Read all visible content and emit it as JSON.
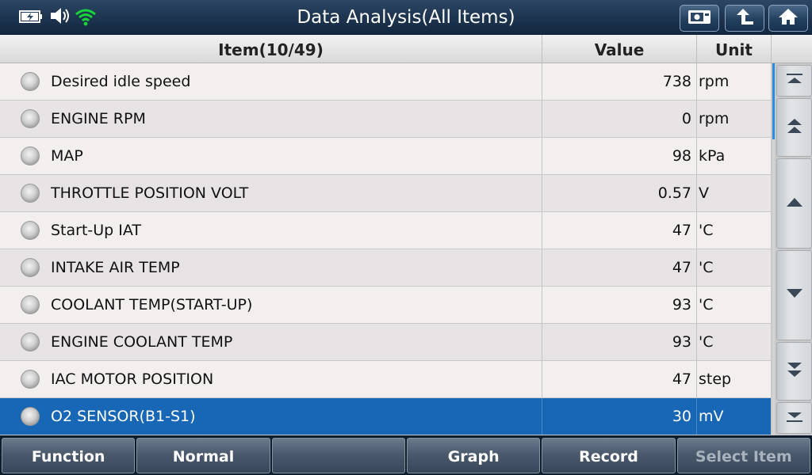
{
  "header": {
    "title": "Data Analysis(All Items)",
    "icons": [
      "battery-icon",
      "volume-icon",
      "wifi-icon"
    ],
    "buttons": [
      "screenshot-icon",
      "back-icon",
      "home-icon"
    ]
  },
  "table": {
    "columns": {
      "item": "Item(10/49)",
      "value": "Value",
      "unit": "Unit"
    },
    "rows": [
      {
        "item": "Desired idle speed",
        "value": "738",
        "unit": "rpm"
      },
      {
        "item": "ENGINE RPM",
        "value": "0",
        "unit": "rpm"
      },
      {
        "item": "MAP",
        "value": "98",
        "unit": "kPa"
      },
      {
        "item": "THROTTLE POSITION VOLT",
        "value": "0.57",
        "unit": "V"
      },
      {
        "item": "Start-Up IAT",
        "value": "47",
        "unit": "'C"
      },
      {
        "item": "INTAKE AIR TEMP",
        "value": "47",
        "unit": "'C"
      },
      {
        "item": "COOLANT TEMP(START-UP)",
        "value": "93",
        "unit": "'C"
      },
      {
        "item": "ENGINE COOLANT TEMP",
        "value": "93",
        "unit": "'C"
      },
      {
        "item": "IAC MOTOR POSITION",
        "value": "47",
        "unit": "step"
      },
      {
        "item": "O2 SENSOR(B1-S1)",
        "value": "30",
        "unit": "mV",
        "selected": true
      }
    ]
  },
  "scroll": {
    "buttons": [
      "scroll-top-icon",
      "page-up-icon",
      "line-up-icon",
      "line-down-icon",
      "page-down-icon",
      "scroll-bottom-icon"
    ]
  },
  "footer": {
    "buttons": [
      {
        "label": "Function",
        "enabled": true
      },
      {
        "label": "Normal",
        "enabled": true
      },
      {
        "label": "",
        "enabled": true
      },
      {
        "label": "Graph",
        "enabled": true
      },
      {
        "label": "Record",
        "enabled": true
      },
      {
        "label": "Select Item",
        "enabled": false
      }
    ]
  },
  "colors": {
    "selected_row": "#1866b6",
    "accent": "#2b8de0",
    "title_bar": "#1e3550"
  }
}
